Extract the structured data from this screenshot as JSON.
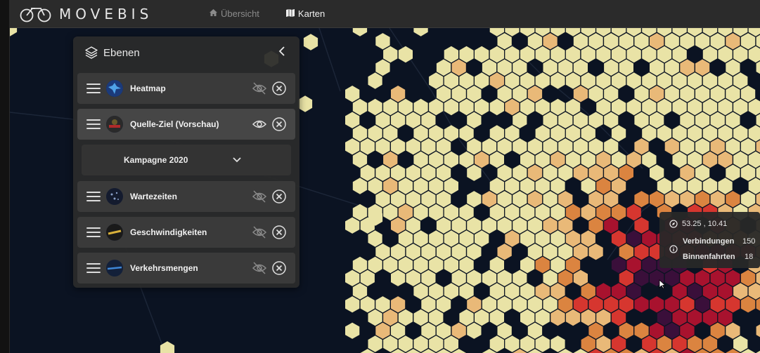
{
  "app": {
    "brand": "MOVEBIS"
  },
  "nav": [
    {
      "label": "Übersicht",
      "icon": "home-icon",
      "active": false
    },
    {
      "label": "Karten",
      "icon": "map-icon",
      "active": true
    }
  ],
  "panel": {
    "title": "Ebenen",
    "layers": [
      {
        "label": "Heatmap",
        "visible": false
      },
      {
        "label": "Quelle-Ziel (Vorschau)",
        "visible": true
      },
      {
        "label": "Wartezeiten",
        "visible": false
      },
      {
        "label": "Geschwindigkeiten",
        "visible": false
      },
      {
        "label": "Verkehrsmengen",
        "visible": false
      }
    ],
    "campaign": {
      "selected": "Kampagne 2020"
    }
  },
  "tooltip": {
    "coords": "53.25 , 10.41",
    "rows": [
      {
        "label": "Verbindungen",
        "value": "150"
      },
      {
        "label": "Binnenfahrten",
        "value": "18"
      }
    ]
  },
  "colors": {
    "light": "#e9e3a6",
    "light_orange": "#e9b978",
    "orange": "#db8440",
    "red": "#d6362f",
    "dark_red": "#a8122e",
    "purple": "#3a0f3a",
    "map_bg": "#0b1322"
  }
}
